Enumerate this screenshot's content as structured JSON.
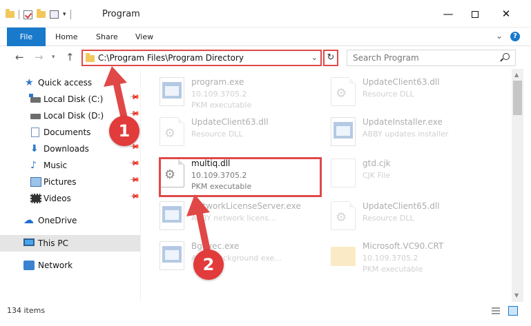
{
  "window": {
    "title": "Program",
    "controls": {
      "minimize": "—",
      "maximize": "",
      "close": "✕"
    }
  },
  "ribbon": {
    "tabs": [
      "File",
      "Home",
      "Share",
      "View"
    ],
    "help": "?"
  },
  "nav": {
    "back": "←",
    "forward": "→",
    "recent": "▾",
    "up": "↑",
    "address": "C:\\Program Files\\Program Directory",
    "address_dropdown": "⌄",
    "refresh": "↻",
    "search_placeholder": "Search Program"
  },
  "sidebar": {
    "items": [
      {
        "label": "Quick access"
      },
      {
        "label": "Local Disk (C:)"
      },
      {
        "label": "Local Disk (D:)"
      },
      {
        "label": "Documents"
      },
      {
        "label": "Downloads"
      },
      {
        "label": "Music"
      },
      {
        "label": "Pictures"
      },
      {
        "label": "Videos"
      },
      {
        "label": "OneDrive"
      },
      {
        "label": "This PC"
      },
      {
        "label": "Network"
      }
    ]
  },
  "files": [
    {
      "name": "program.exe",
      "line1": "10.109.3705.2",
      "line2": "PKM executable"
    },
    {
      "name": "UpdateClient63.dll",
      "line1": "Resource DLL",
      "line2": ""
    },
    {
      "name": "UpdateClient63.dll",
      "line1": "Resource DLL",
      "line2": ""
    },
    {
      "name": "UpdateInstaller.exe",
      "line1": "ABBY updates installer",
      "line2": ""
    },
    {
      "name": "multiq.dll",
      "line1": "10.109.3705.2",
      "line2": "PKM executable"
    },
    {
      "name": "gtd.cjk",
      "line1": "CJK File",
      "line2": ""
    },
    {
      "name": "NetworkLicenseServer.exe",
      "line1": "ABBY network licens...",
      "line2": ""
    },
    {
      "name": "UpdateClient65.dll",
      "line1": "Resource DLL",
      "line2": ""
    },
    {
      "name": "BgExec.exe",
      "line1": "ABBY background exe...",
      "line2": ""
    },
    {
      "name": "Microsoft.VC90.CRT",
      "line1": "10.109.3705.2",
      "line2": "PKM executable"
    }
  ],
  "status": {
    "count": "134 items"
  },
  "annotations": {
    "step1": "1",
    "step2": "2",
    "color": "#e04848"
  },
  "colors": {
    "accent": "#1979ca",
    "highlight": "#e04848",
    "selected_bg": "#e5e5e5"
  }
}
